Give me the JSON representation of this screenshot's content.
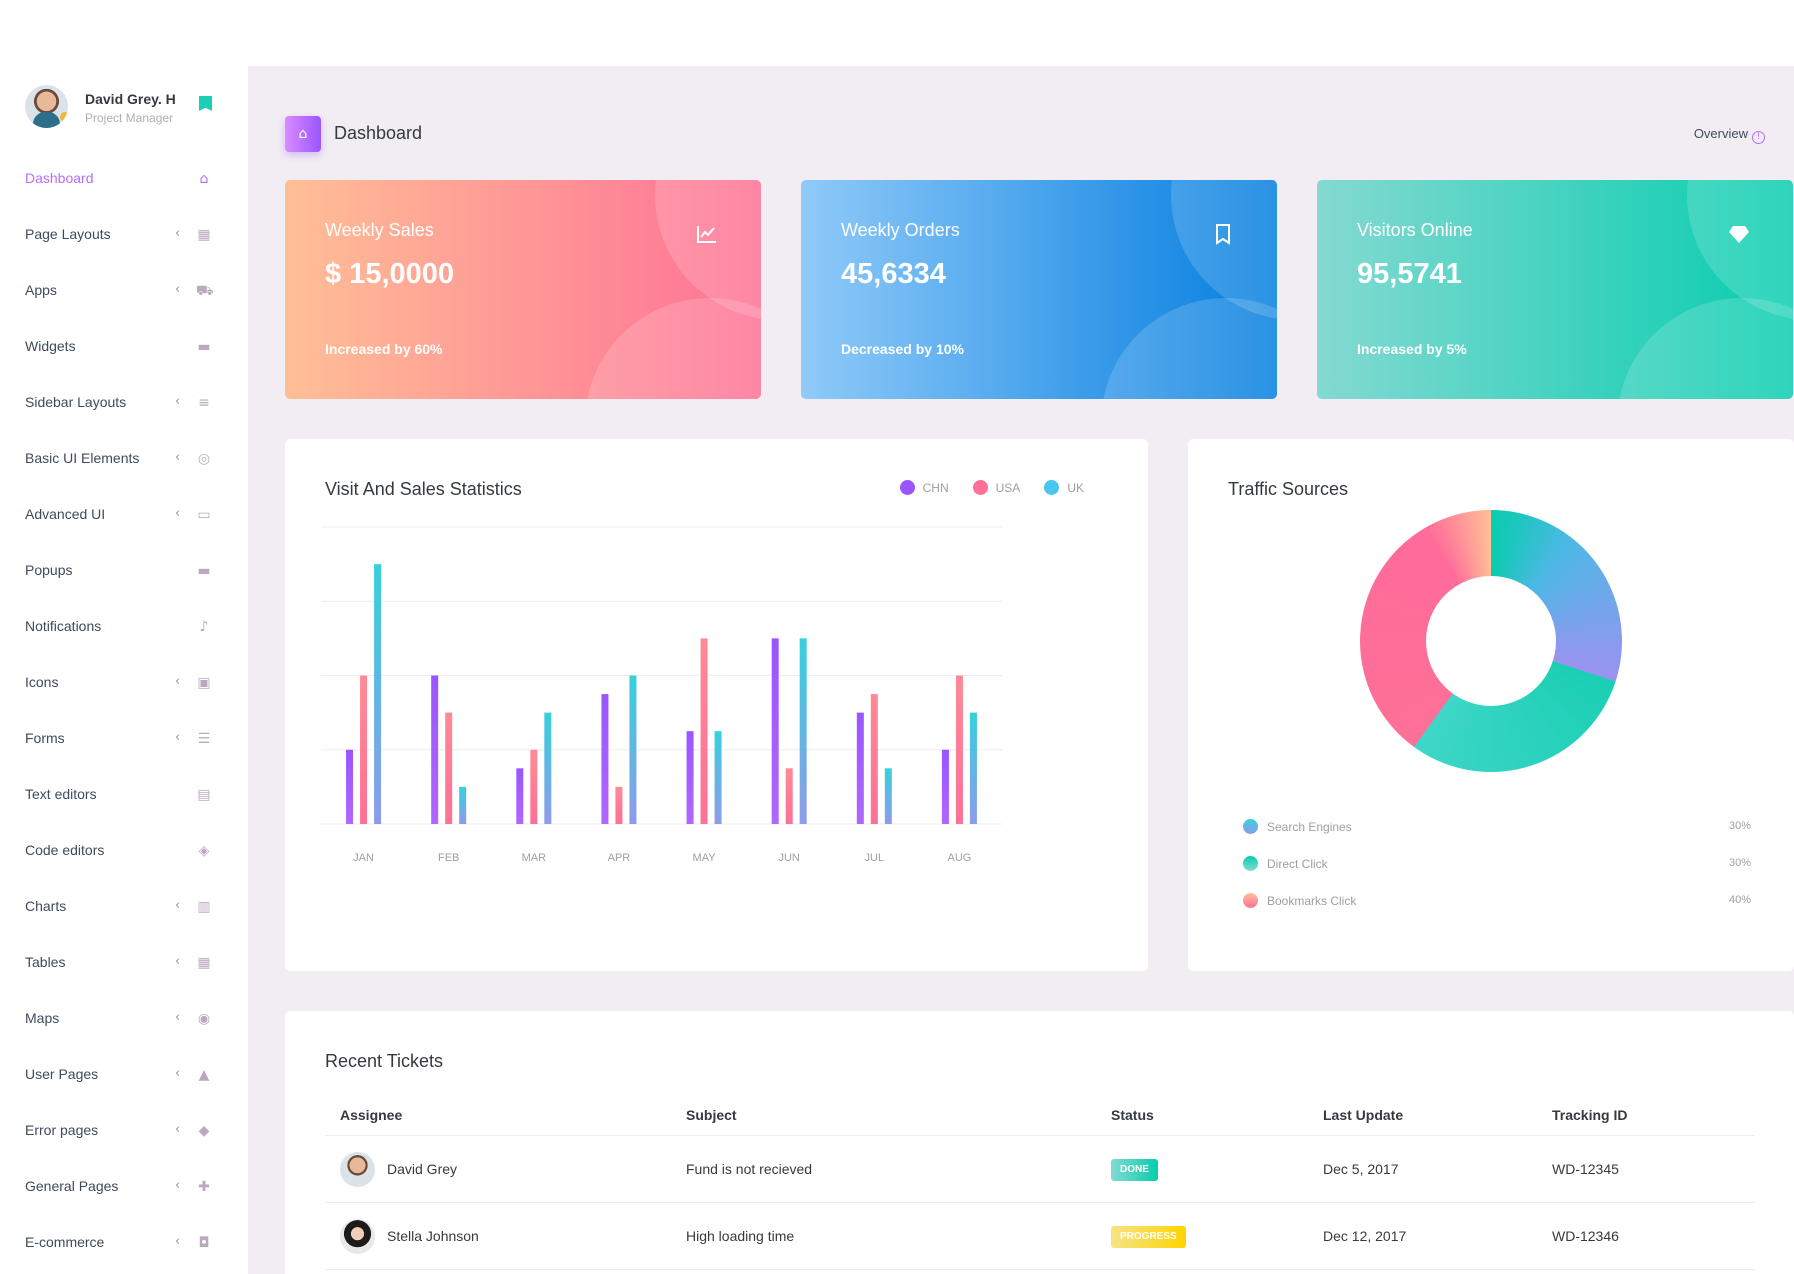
{
  "profile": {
    "name": "David Grey. H",
    "role": "Project Manager"
  },
  "sidebar": {
    "items": [
      {
        "label": "Dashboard",
        "icon": "home-icon",
        "has_arrow": false,
        "active": true
      },
      {
        "label": "Page Layouts",
        "icon": "grid-icon",
        "has_arrow": true
      },
      {
        "label": "Apps",
        "icon": "cart-icon",
        "has_arrow": true
      },
      {
        "label": "Widgets",
        "icon": "chat-icon",
        "has_arrow": false
      },
      {
        "label": "Sidebar Layouts",
        "icon": "playlist-icon",
        "has_arrow": true
      },
      {
        "label": "Basic UI Elements",
        "icon": "crosshair-icon",
        "has_arrow": true
      },
      {
        "label": "Advanced UI",
        "icon": "monitor-icon",
        "has_arrow": true
      },
      {
        "label": "Popups",
        "icon": "chat-icon",
        "has_arrow": false
      },
      {
        "label": "Notifications",
        "icon": "bell-icon",
        "has_arrow": false
      },
      {
        "label": "Icons",
        "icon": "contacts-icon",
        "has_arrow": true
      },
      {
        "label": "Forms",
        "icon": "list-icon",
        "has_arrow": true
      },
      {
        "label": "Text editors",
        "icon": "document-icon",
        "has_arrow": false
      },
      {
        "label": "Code editors",
        "icon": "code-icon",
        "has_arrow": false
      },
      {
        "label": "Charts",
        "icon": "bar-chart-icon",
        "has_arrow": true
      },
      {
        "label": "Tables",
        "icon": "table-icon",
        "has_arrow": true
      },
      {
        "label": "Maps",
        "icon": "map-marker-icon",
        "has_arrow": true
      },
      {
        "label": "User Pages",
        "icon": "lock-icon",
        "has_arrow": true
      },
      {
        "label": "Error pages",
        "icon": "shield-icon",
        "has_arrow": true
      },
      {
        "label": "General Pages",
        "icon": "medical-bag-icon",
        "has_arrow": true
      },
      {
        "label": "E-commerce",
        "icon": "shopping-bag-icon",
        "has_arrow": true
      }
    ]
  },
  "header": {
    "title": "Dashboard",
    "overview": "Overview"
  },
  "stats": [
    {
      "title": "Weekly Sales",
      "value": "$ 15,0000",
      "foot": "Increased by 60%",
      "icon": "chart-line-icon"
    },
    {
      "title": "Weekly Orders",
      "value": "45,6334",
      "foot": "Decreased by 10%",
      "icon": "bookmark-outline-icon"
    },
    {
      "title": "Visitors Online",
      "value": "95,5741",
      "foot": "Increased by 5%",
      "icon": "diamond-icon"
    }
  ],
  "chart_panel": {
    "title": "Visit And Sales Statistics"
  },
  "chart_data": {
    "type": "bar",
    "categories": [
      "JAN",
      "FEB",
      "MAR",
      "APR",
      "MAY",
      "JUN",
      "JUL",
      "AUG"
    ],
    "series": [
      {
        "name": "CHN",
        "color": "#9a55ff",
        "values": [
          20,
          40,
          15,
          35,
          25,
          50,
          30,
          20
        ]
      },
      {
        "name": "USA",
        "color": "#fe7096",
        "values": [
          40,
          30,
          20,
          10,
          50,
          15,
          35,
          40
        ]
      },
      {
        "name": "UK",
        "color": "#47c6ef",
        "values": [
          70,
          10,
          30,
          40,
          25,
          50,
          15,
          30
        ]
      }
    ],
    "ylim": [
      0,
      80
    ],
    "grid": true,
    "legend": "top-right"
  },
  "traffic": {
    "title": "Traffic Sources",
    "items": [
      {
        "label": "Search Engines",
        "pct": "30%",
        "color": "#47c6ef"
      },
      {
        "label": "Direct Click",
        "pct": "30%",
        "color": "#1bcfb4"
      },
      {
        "label": "Bookmarks Click",
        "pct": "40%",
        "color": "#fe7096"
      }
    ]
  },
  "tickets": {
    "title": "Recent Tickets",
    "columns": [
      "Assignee",
      "Subject",
      "Status",
      "Last Update",
      "Tracking ID"
    ],
    "rows": [
      {
        "assignee": "David Grey",
        "subject": "Fund is not recieved",
        "status": "DONE",
        "updated": "Dec 5, 2017",
        "tracking": "WD-12345"
      },
      {
        "assignee": "Stella Johnson",
        "subject": "High loading time",
        "status": "PROGRESS",
        "updated": "Dec 12, 2017",
        "tracking": "WD-12346"
      }
    ]
  }
}
